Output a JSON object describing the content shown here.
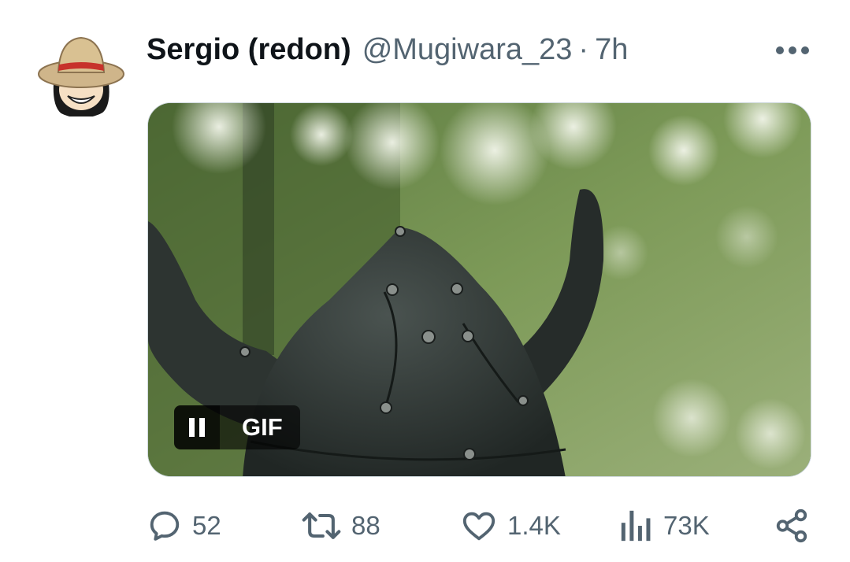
{
  "tweet": {
    "display_name": "Sergio (redon)",
    "handle": "@Mugiwara_23",
    "separator": "·",
    "time": "7h",
    "more_icon": "more-horizontal-icon"
  },
  "media": {
    "badge_label": "GIF",
    "control_icon": "pause-icon"
  },
  "actions": {
    "reply": {
      "icon": "reply-icon",
      "count": "52"
    },
    "retweet": {
      "icon": "retweet-icon",
      "count": "88"
    },
    "like": {
      "icon": "heart-icon",
      "count": "1.4K"
    },
    "views": {
      "icon": "views-chart-icon",
      "count": "73K"
    },
    "share": {
      "icon": "share-icon"
    }
  },
  "colors": {
    "text_primary": "#0f1419",
    "text_secondary": "#536471",
    "border": "#cfd9de"
  }
}
